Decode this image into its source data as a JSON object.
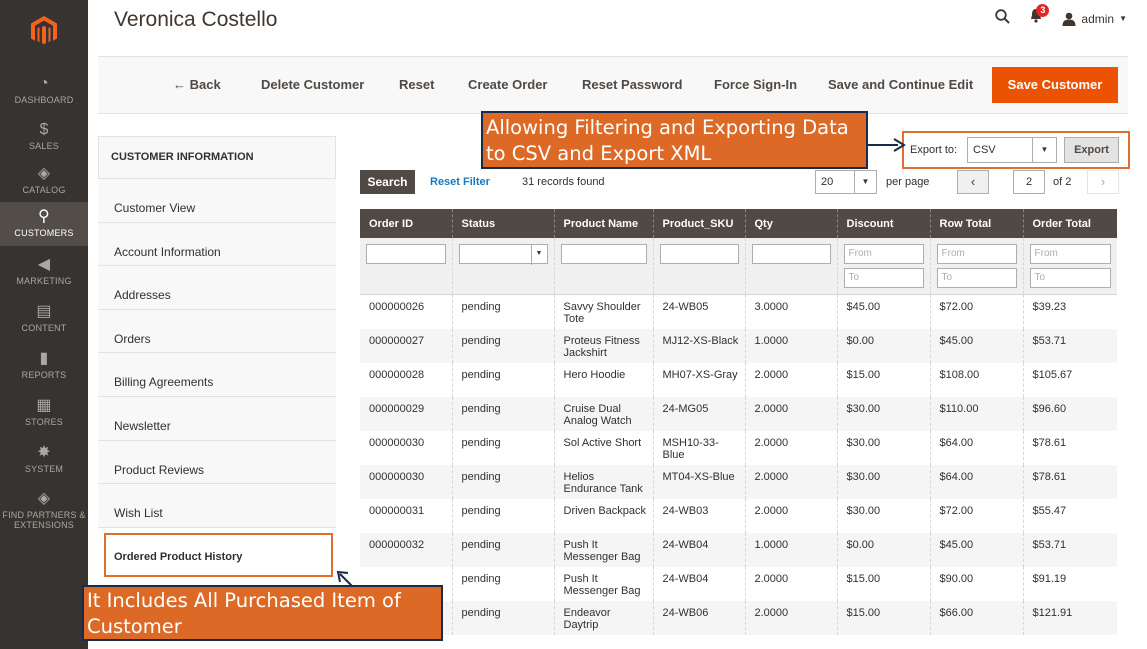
{
  "header": {
    "title": "Veronica Costello",
    "notification_count": "3",
    "user_label": "admin"
  },
  "nav": {
    "items": [
      {
        "label": "DASHBOARD",
        "icon": "dashboard-icon"
      },
      {
        "label": "SALES",
        "icon": "dollar-icon"
      },
      {
        "label": "CATALOG",
        "icon": "cube-icon"
      },
      {
        "label": "CUSTOMERS",
        "icon": "person-icon"
      },
      {
        "label": "MARKETING",
        "icon": "megaphone-icon"
      },
      {
        "label": "CONTENT",
        "icon": "layout-icon"
      },
      {
        "label": "REPORTS",
        "icon": "bar-chart-icon"
      },
      {
        "label": "STORES",
        "icon": "store-icon"
      },
      {
        "label": "SYSTEM",
        "icon": "gear-icon"
      },
      {
        "label": "FIND PARTNERS & EXTENSIONS",
        "icon": "box-icon"
      }
    ]
  },
  "toolbar": {
    "back": "← Back",
    "delete": "Delete Customer",
    "reset": "Reset",
    "create_order": "Create Order",
    "reset_password": "Reset Password",
    "force_signin": "Force Sign-In",
    "save_continue": "Save and Continue Edit",
    "save": "Save Customer"
  },
  "sidebar": {
    "heading": "CUSTOMER INFORMATION",
    "tabs": [
      "Customer View",
      "Account Information",
      "Addresses",
      "Orders",
      "Billing Agreements",
      "Newsletter",
      "Product Reviews",
      "Wish List",
      "Ordered Product History"
    ]
  },
  "grid": {
    "search": "Search",
    "reset_filter": "Reset Filter",
    "records": "31 records found",
    "page_size": "20",
    "per_page": "per page",
    "current_page": "2",
    "of_pages": "of 2",
    "export_label": "Export to:",
    "export_format": "CSV",
    "export_button": "Export",
    "filter_from": "From",
    "filter_to": "To",
    "columns": [
      "Order ID",
      "Status",
      "Product Name",
      "Product_SKU",
      "Qty",
      "Discount",
      "Row Total",
      "Order Total"
    ],
    "rows": [
      [
        "000000026",
        "pending",
        "Savvy Shoulder Tote",
        "24-WB05",
        "3.0000",
        "$45.00",
        "$72.00",
        "$39.23"
      ],
      [
        "000000027",
        "pending",
        "Proteus Fitness Jackshirt",
        "MJ12-XS-Black",
        "1.0000",
        "$0.00",
        "$45.00",
        "$53.71"
      ],
      [
        "000000028",
        "pending",
        "Hero Hoodie",
        "MH07-XS-Gray",
        "2.0000",
        "$15.00",
        "$108.00",
        "$105.67"
      ],
      [
        "000000029",
        "pending",
        "Cruise Dual Analog Watch",
        "24-MG05",
        "2.0000",
        "$30.00",
        "$110.00",
        "$96.60"
      ],
      [
        "000000030",
        "pending",
        "Sol Active Short",
        "MSH10-33-Blue",
        "2.0000",
        "$30.00",
        "$64.00",
        "$78.61"
      ],
      [
        "000000030",
        "pending",
        "Helios Endurance Tank",
        "MT04-XS-Blue",
        "2.0000",
        "$30.00",
        "$64.00",
        "$78.61"
      ],
      [
        "000000031",
        "pending",
        "Driven Backpack",
        "24-WB03",
        "2.0000",
        "$30.00",
        "$72.00",
        "$55.47"
      ],
      [
        "000000032",
        "pending",
        "Push It Messenger Bag",
        "24-WB04",
        "1.0000",
        "$0.00",
        "$45.00",
        "$53.71"
      ],
      [
        "",
        "pending",
        "Push It Messenger Bag",
        "24-WB04",
        "2.0000",
        "$15.00",
        "$90.00",
        "$91.19"
      ],
      [
        "",
        "pending",
        "Endeavor Daytrip",
        "24-WB06",
        "2.0000",
        "$15.00",
        "$66.00",
        "$121.91"
      ]
    ]
  },
  "annotations": {
    "top": "Allowing Filtering and Exporting Data to CSV and Export XML",
    "bottom": "It Includes All Purchased Item of Customer"
  },
  "colors": {
    "nav_bg": "#373330",
    "accent": "#eb5202",
    "grid_header": "#514943",
    "callout": "#dc6a26",
    "link": "#1979c3"
  }
}
